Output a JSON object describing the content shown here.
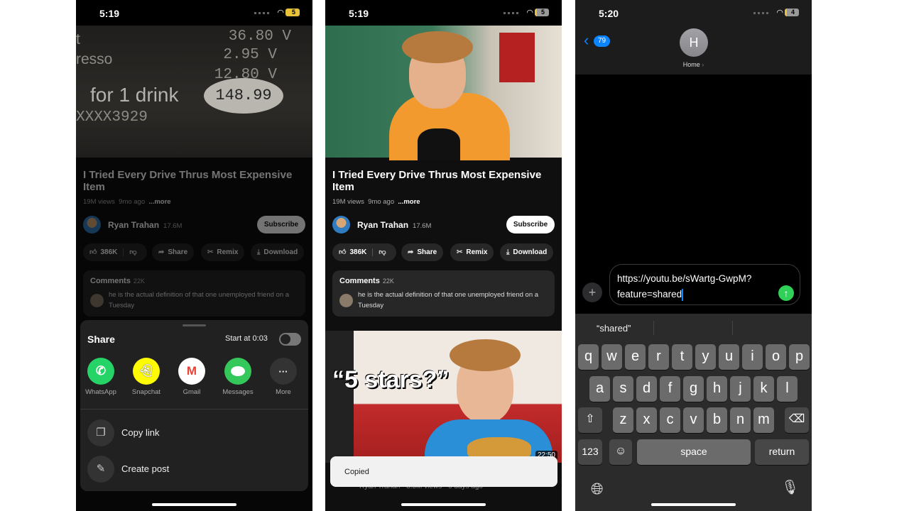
{
  "video": {
    "title": "I Tried Every Drive Thrus Most Expensive Item",
    "views": "19M views",
    "age": "9mo ago",
    "more": "...more",
    "channel": "Ryan Trahan",
    "subscribers": "17.6M",
    "subscribe_label": "Subscribe",
    "likes": "386K",
    "share_label": "Share",
    "remix_label": "Remix",
    "download_label": "Download",
    "comments_label": "Comments",
    "comments_count": "22K",
    "top_comment": "he is the actual definition of that one unemployed friend on a Tuesday"
  },
  "panel1": {
    "time": "5:19",
    "battery": "5",
    "thumb_text": {
      "line1": "36.80 V",
      "line2": "2.95 V",
      "line3": "12.80 V",
      "caption": "for 1 drink",
      "price": "148.99",
      "code": "XXXX3929",
      "left1": "t",
      "left2": "resso"
    },
    "share": {
      "title": "Share",
      "start_at": "Start at 0:03",
      "start_toggle_on": false,
      "apps": [
        {
          "label": "WhatsApp",
          "icon": "whatsapp-icon",
          "color": "#25d366"
        },
        {
          "label": "Snapchat",
          "icon": "snapchat-icon",
          "color": "#fffc00"
        },
        {
          "label": "Gmail",
          "icon": "gmail-icon",
          "color": "#ffffff"
        },
        {
          "label": "Messages",
          "icon": "messages-icon",
          "color": "#34c759"
        },
        {
          "label": "More",
          "icon": "more-icon",
          "color": "#333333"
        }
      ],
      "copy_link": "Copy link",
      "create_post": "Create post"
    }
  },
  "panel2": {
    "time": "5:19",
    "battery": "5",
    "next_thumb_text": "“5 stars?”",
    "duration": "22:50",
    "next_meta": "Ryan Trahan · 8.5M views · 6 days ago",
    "toast": "Copied"
  },
  "panel3": {
    "time": "5:20",
    "battery": "4",
    "back_badge": "79",
    "contact_initial": "H",
    "contact_name": "Home",
    "message_text_1": "https://youtu.be/sWartg-GwpM?",
    "message_text_2": "feature=shared",
    "suggestion": "“shared”",
    "keyboard": {
      "row1": [
        "q",
        "w",
        "e",
        "r",
        "t",
        "y",
        "u",
        "i",
        "o",
        "p"
      ],
      "row2": [
        "a",
        "s",
        "d",
        "f",
        "g",
        "h",
        "j",
        "k",
        "l"
      ],
      "row3": [
        "z",
        "x",
        "c",
        "v",
        "b",
        "n",
        "m"
      ],
      "numbers": "123",
      "space": "space",
      "return": "return"
    },
    "send_color": "#30d158",
    "accent": "#0a84ff"
  }
}
